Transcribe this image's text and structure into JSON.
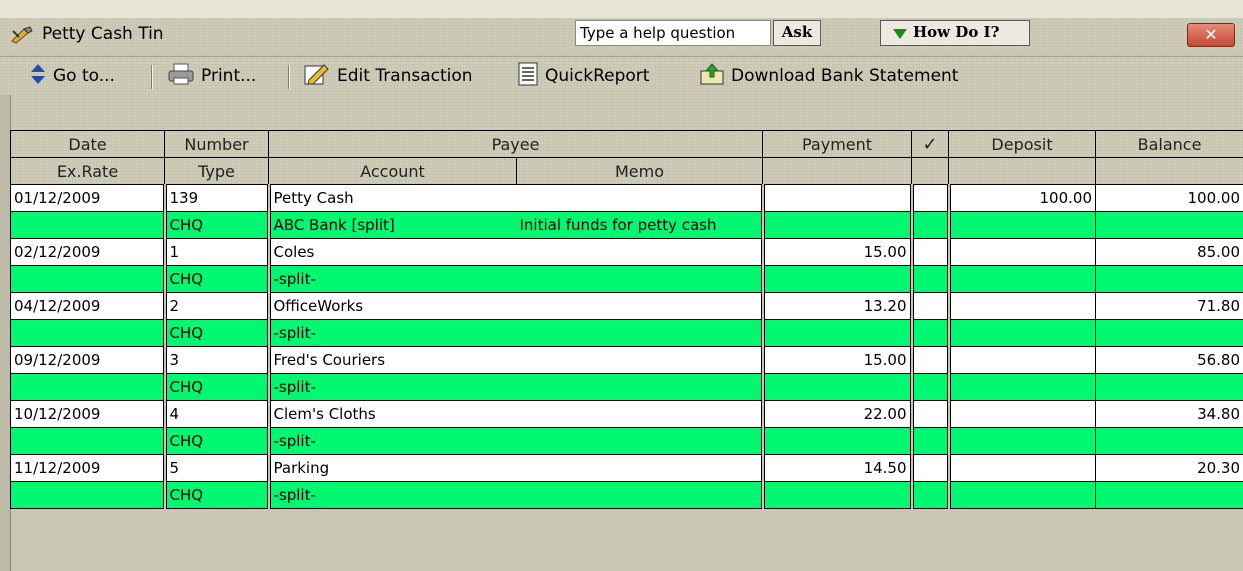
{
  "window": {
    "title": "Petty Cash Tin",
    "help_placeholder": "Type a help question",
    "ask_label": "Ask",
    "howdoi_label": "How Do I?",
    "close_label": "✕"
  },
  "toolbar": {
    "goto_label": "Go to...",
    "print_label": "Print...",
    "edit_label": "Edit Transaction",
    "quickreport_label": "QuickReport",
    "download_label": "Download Bank Statement"
  },
  "header": {
    "row1": [
      "Date",
      "Number",
      "Payee",
      "Payment",
      "✓",
      "Deposit",
      "Balance"
    ],
    "row2": [
      "Ex.Rate",
      "Type",
      "Account",
      "Memo"
    ]
  },
  "transactions": [
    {
      "date": "01/12/2009",
      "number": "139",
      "payee": "Petty Cash",
      "payment": "",
      "deposit": "100.00",
      "balance": "100.00",
      "type": "CHQ",
      "account": "ABC Bank [split]",
      "memo": "Initial funds for petty cash"
    },
    {
      "date": "02/12/2009",
      "number": "1",
      "payee": "Coles",
      "payment": "15.00",
      "deposit": "",
      "balance": "85.00",
      "type": "CHQ",
      "account": "-split-",
      "memo": ""
    },
    {
      "date": "04/12/2009",
      "number": "2",
      "payee": "OfficeWorks",
      "payment": "13.20",
      "deposit": "",
      "balance": "71.80",
      "type": "CHQ",
      "account": "-split-",
      "memo": ""
    },
    {
      "date": "09/12/2009",
      "number": "3",
      "payee": "Fred's Couriers",
      "payment": "15.00",
      "deposit": "",
      "balance": "56.80",
      "type": "CHQ",
      "account": "-split-",
      "memo": ""
    },
    {
      "date": "10/12/2009",
      "number": "4",
      "payee": "Clem's Cloths",
      "payment": "22.00",
      "deposit": "",
      "balance": "34.80",
      "type": "CHQ",
      "account": "-split-",
      "memo": ""
    },
    {
      "date": "11/12/2009",
      "number": "5",
      "payee": "Parking",
      "payment": "14.50",
      "deposit": "",
      "balance": "20.30",
      "type": "CHQ",
      "account": "-split-",
      "memo": ""
    }
  ],
  "colors": {
    "split_row": "#00f871",
    "close_button": "#c24a35",
    "howdoi_arrow": "#1a8c1a"
  }
}
